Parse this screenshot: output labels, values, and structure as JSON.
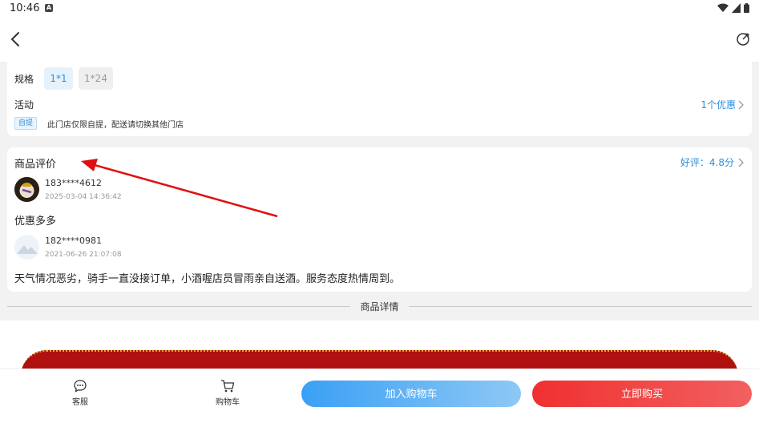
{
  "status_bar": {
    "time": "10:46",
    "a_icon": "A",
    "icons": [
      "wifi-icon",
      "signal-icon",
      "battery-icon"
    ]
  },
  "nav": {
    "back_icon": "chevron-left-icon",
    "share_icon": "share-icon"
  },
  "spec": {
    "label": "规格",
    "options": [
      {
        "label": "1*1",
        "selected": true
      },
      {
        "label": "1*24",
        "selected": false
      }
    ]
  },
  "activity": {
    "label": "活动",
    "link": "1个优惠",
    "tag": "自提",
    "text": "此门店仅限自提，配送请切换其他门店"
  },
  "reviews": {
    "title": "商品评价",
    "score": "好评：4.8分",
    "items": [
      {
        "user": "183****4612",
        "date": "2025-03-04 14:36:42",
        "comment": "优惠多多"
      },
      {
        "user": "182****0981",
        "date": "2021-06-26 21:07:08",
        "comment": "天气情况恶劣，骑手一直没接订单，小酒喔店员冒雨亲自送酒。服务态度热情周到。"
      }
    ]
  },
  "detail_divider": "商品详情",
  "bottom_bar": {
    "service_label": "客服",
    "cart_label": "购物车",
    "add_to_cart": "加入购物车",
    "buy_now": "立即购买"
  },
  "colors": {
    "accent": "#2d8fdc",
    "buy": "#f03030",
    "annotation": "#e01010"
  }
}
